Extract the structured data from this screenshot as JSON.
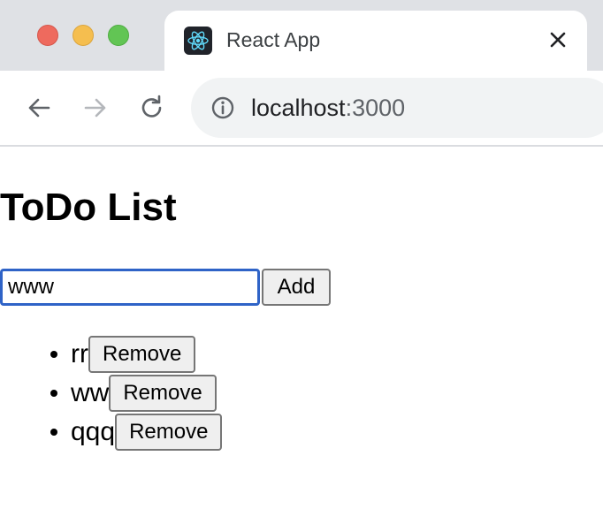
{
  "browser": {
    "tab_title": "React App",
    "url_host": "localhost",
    "url_port": ":3000",
    "icons": {
      "favicon": "react-icon",
      "close": "close-icon",
      "back": "arrow-left-icon",
      "forward": "arrow-right-icon",
      "reload": "reload-icon",
      "info": "info-icon"
    },
    "colors": {
      "close_dot": "#ee6a5e",
      "minimize_dot": "#f5be4f",
      "maximize_dot": "#62c554"
    }
  },
  "app": {
    "title": "ToDo List",
    "input_value": "www",
    "add_label": "Add",
    "items": [
      {
        "text": "rr",
        "remove_label": "Remove"
      },
      {
        "text": "ww",
        "remove_label": "Remove"
      },
      {
        "text": "qqq",
        "remove_label": "Remove"
      }
    ],
    "colors": {
      "input_focus_border": "#2f63c7"
    }
  }
}
